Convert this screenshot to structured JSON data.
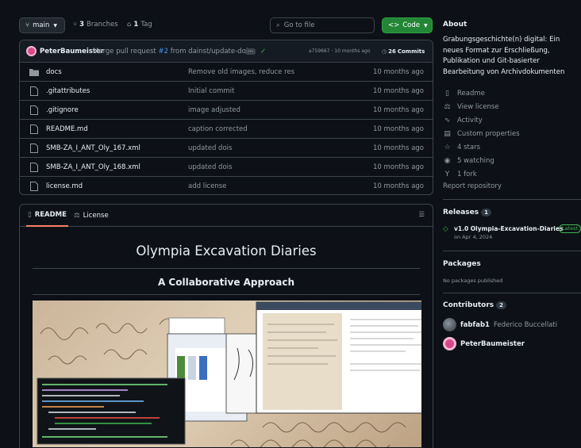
{
  "toolbar": {
    "branch": "main",
    "branches_count": "3",
    "branches_label": "Branches",
    "tags_count": "1",
    "tags_label": "Tag",
    "goto_placeholder": "Go to file",
    "code_label": "Code"
  },
  "commit": {
    "author": "PeterBaumeister",
    "message_prefix": "Merge pull request",
    "pr": "#2",
    "message_suffix": "from dainst/update-dois",
    "hash_time": "a759667 · 10 months ago",
    "commits_count": "26",
    "commits_label": "Commits"
  },
  "files": [
    {
      "type": "folder",
      "name": "docs",
      "message": "Remove old images, reduce res",
      "date": "10 months ago"
    },
    {
      "type": "file",
      "name": ".gitattributes",
      "message": "Initial commit",
      "date": "10 months ago"
    },
    {
      "type": "file",
      "name": ".gitignore",
      "message": "image adjusted",
      "date": "10 months ago"
    },
    {
      "type": "file",
      "name": "README.md",
      "message": "caption corrected",
      "date": "10 months ago"
    },
    {
      "type": "file",
      "name": "SMB-ZA_I_ANT_Oly_167.xml",
      "message": "updated dois",
      "date": "10 months ago"
    },
    {
      "type": "file",
      "name": "SMB-ZA_I_ANT_Oly_168.xml",
      "message": "updated dois",
      "date": "10 months ago"
    },
    {
      "type": "file",
      "name": "license.md",
      "message": "add license",
      "date": "10 months ago"
    }
  ],
  "readme": {
    "tab_readme": "README",
    "tab_license": "License",
    "title": "Olympia Excavation Diaries",
    "subtitle": "A Collaborative Approach"
  },
  "about": {
    "heading": "About",
    "description": "Grabungsgeschichte(n) digital: Ein neues Format zur Erschließung, Publikation und Git-basierter Bearbeitung von Archivdokumenten",
    "links": [
      {
        "icon": "book-icon",
        "label": "Readme"
      },
      {
        "icon": "scale-icon",
        "label": "View license"
      },
      {
        "icon": "pulse-icon",
        "label": "Activity"
      },
      {
        "icon": "note-icon",
        "label": "Custom properties"
      },
      {
        "icon": "star-icon",
        "label": "4 stars"
      },
      {
        "icon": "eye-icon",
        "label": "5 watching"
      },
      {
        "icon": "fork-icon",
        "label": "1 fork"
      }
    ],
    "report": "Report repository"
  },
  "releases": {
    "heading": "Releases",
    "count": "1",
    "name": "v1.0 Olympia-Excavation-Diaries",
    "badge": "Latest",
    "date": "on Apr 4, 2024"
  },
  "packages": {
    "heading": "Packages",
    "empty": "No packages published"
  },
  "contributors": {
    "heading": "Contributors",
    "count": "2",
    "list": [
      {
        "login": "fabfab1",
        "name": "Federico Buccellati"
      },
      {
        "login": "PeterBaumeister",
        "name": ""
      }
    ]
  },
  "colors": {
    "accent_green": "#238636",
    "link_blue": "#4493f8",
    "tab_underline": "#f78166"
  }
}
